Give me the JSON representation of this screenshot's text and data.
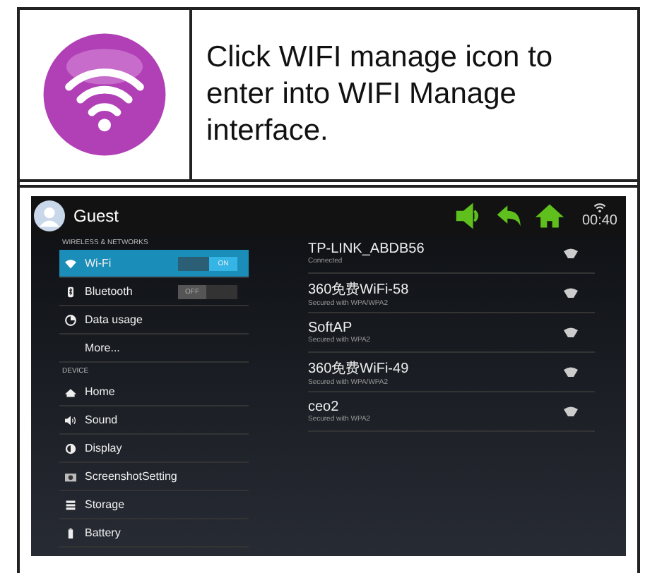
{
  "instruction": {
    "text": "Click WIFI manage icon to enter into WIFI Manage interface."
  },
  "screenshot": {
    "action_bar": {
      "title": "Guest",
      "time": "00:40"
    },
    "settings": [
      {
        "kind": "header",
        "label": "WIRELESS & NETWORKS"
      },
      {
        "kind": "wifi",
        "label": "Wi-Fi",
        "selected": true,
        "toggle": {
          "label": "ON",
          "on": true
        }
      },
      {
        "kind": "bluetooth",
        "label": "Bluetooth",
        "selected": false,
        "toggle": {
          "label": "OFF",
          "on": false
        }
      },
      {
        "kind": "data",
        "label": "Data usage",
        "selected": false
      },
      {
        "kind": "plain",
        "label": "More...",
        "selected": false
      },
      {
        "kind": "header",
        "label": "DEVICE"
      },
      {
        "kind": "home",
        "label": "Home",
        "selected": false
      },
      {
        "kind": "sound",
        "label": "Sound",
        "selected": false
      },
      {
        "kind": "display",
        "label": "Display",
        "selected": false
      },
      {
        "kind": "camera",
        "label": "ScreenshotSetting",
        "selected": false
      },
      {
        "kind": "storage",
        "label": "Storage",
        "selected": false
      },
      {
        "kind": "battery",
        "label": "Battery",
        "selected": false
      }
    ],
    "networks": [
      {
        "name": "TP-LINK_ABDB56",
        "status": "Connected"
      },
      {
        "name": "360免费WiFi-58",
        "status": "Secured with WPA/WPA2"
      },
      {
        "name": "SoftAP",
        "status": "Secured with WPA2"
      },
      {
        "name": "360免费WiFi-49",
        "status": "Secured with WPA/WPA2"
      },
      {
        "name": "ceo2",
        "status": "Secured with WPA2"
      }
    ]
  }
}
